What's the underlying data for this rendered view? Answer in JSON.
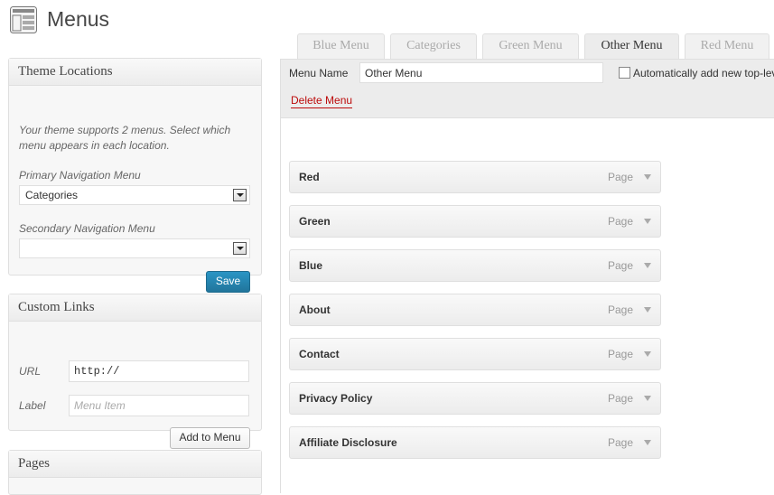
{
  "header": {
    "title": "Menus",
    "icon": "menus-icon"
  },
  "theme_locations": {
    "title": "Theme Locations",
    "description": "Your theme supports 2 menus. Select which menu appears in each location.",
    "primary_label": "Primary Navigation Menu",
    "primary_value": "Categories",
    "secondary_label": "Secondary Navigation Menu",
    "secondary_value": "",
    "save_label": "Save"
  },
  "custom_links": {
    "title": "Custom Links",
    "url_label": "URL",
    "url_value": "http://",
    "label_label": "Label",
    "label_placeholder": "Menu Item",
    "add_label": "Add to Menu"
  },
  "pages_box": {
    "title": "Pages"
  },
  "tabs": [
    "Blue Menu",
    "Categories",
    "Green Menu",
    "Other Menu",
    "Red Menu"
  ],
  "active_tab": "Other Menu",
  "menu_editor": {
    "name_label": "Menu Name",
    "name_value": "Other Menu",
    "auto_add_label": "Automatically add new top-lev",
    "delete_label": "Delete Menu"
  },
  "menu_items": [
    {
      "name": "Red",
      "type": "Page"
    },
    {
      "name": "Green",
      "type": "Page"
    },
    {
      "name": "Blue",
      "type": "Page"
    },
    {
      "name": "About",
      "type": "Page"
    },
    {
      "name": "Contact",
      "type": "Page"
    },
    {
      "name": "Privacy Policy",
      "type": "Page"
    },
    {
      "name": "Affiliate Disclosure",
      "type": "Page"
    }
  ],
  "colors": {
    "primary_button": "#21759b",
    "delete_link": "#bc0b0b"
  }
}
